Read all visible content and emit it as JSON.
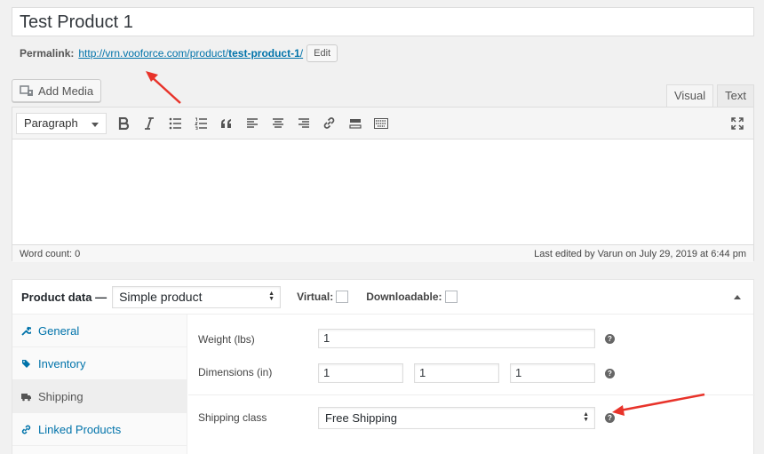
{
  "post": {
    "title": "Test Product 1"
  },
  "permalink": {
    "label": "Permalink:",
    "url_base": "http://vrn.vooforce.com/product/",
    "slug": "test-product-1",
    "url_end": "/",
    "edit_label": "Edit"
  },
  "media": {
    "add_media_label": "Add Media"
  },
  "editor": {
    "tabs": [
      {
        "label": "Visual",
        "active": true
      },
      {
        "label": "Text",
        "active": false
      }
    ],
    "format_value": "Paragraph",
    "word_count": "Word count: 0",
    "last_edited": "Last edited by Varun on July 29, 2019 at 6:44 pm"
  },
  "product_data": {
    "title": "Product data —",
    "type_value": "Simple product",
    "virtual_label": "Virtual:",
    "downloadable_label": "Downloadable:",
    "tabs": [
      {
        "label": "General",
        "icon": "wrench-icon",
        "active": false
      },
      {
        "label": "Inventory",
        "icon": "tag-icon",
        "active": false
      },
      {
        "label": "Shipping",
        "icon": "truck-icon",
        "active": true
      },
      {
        "label": "Linked Products",
        "icon": "link-icon",
        "active": false
      }
    ],
    "shipping": {
      "weight_label": "Weight (lbs)",
      "weight_value": "1",
      "dimensions_label": "Dimensions (in)",
      "length_value": "1",
      "width_value": "1",
      "height_value": "1",
      "class_label": "Shipping class",
      "class_value": "Free Shipping",
      "help_glyph": "?"
    }
  },
  "colors": {
    "link": "#0073aa",
    "arrow": "#e8332a"
  }
}
